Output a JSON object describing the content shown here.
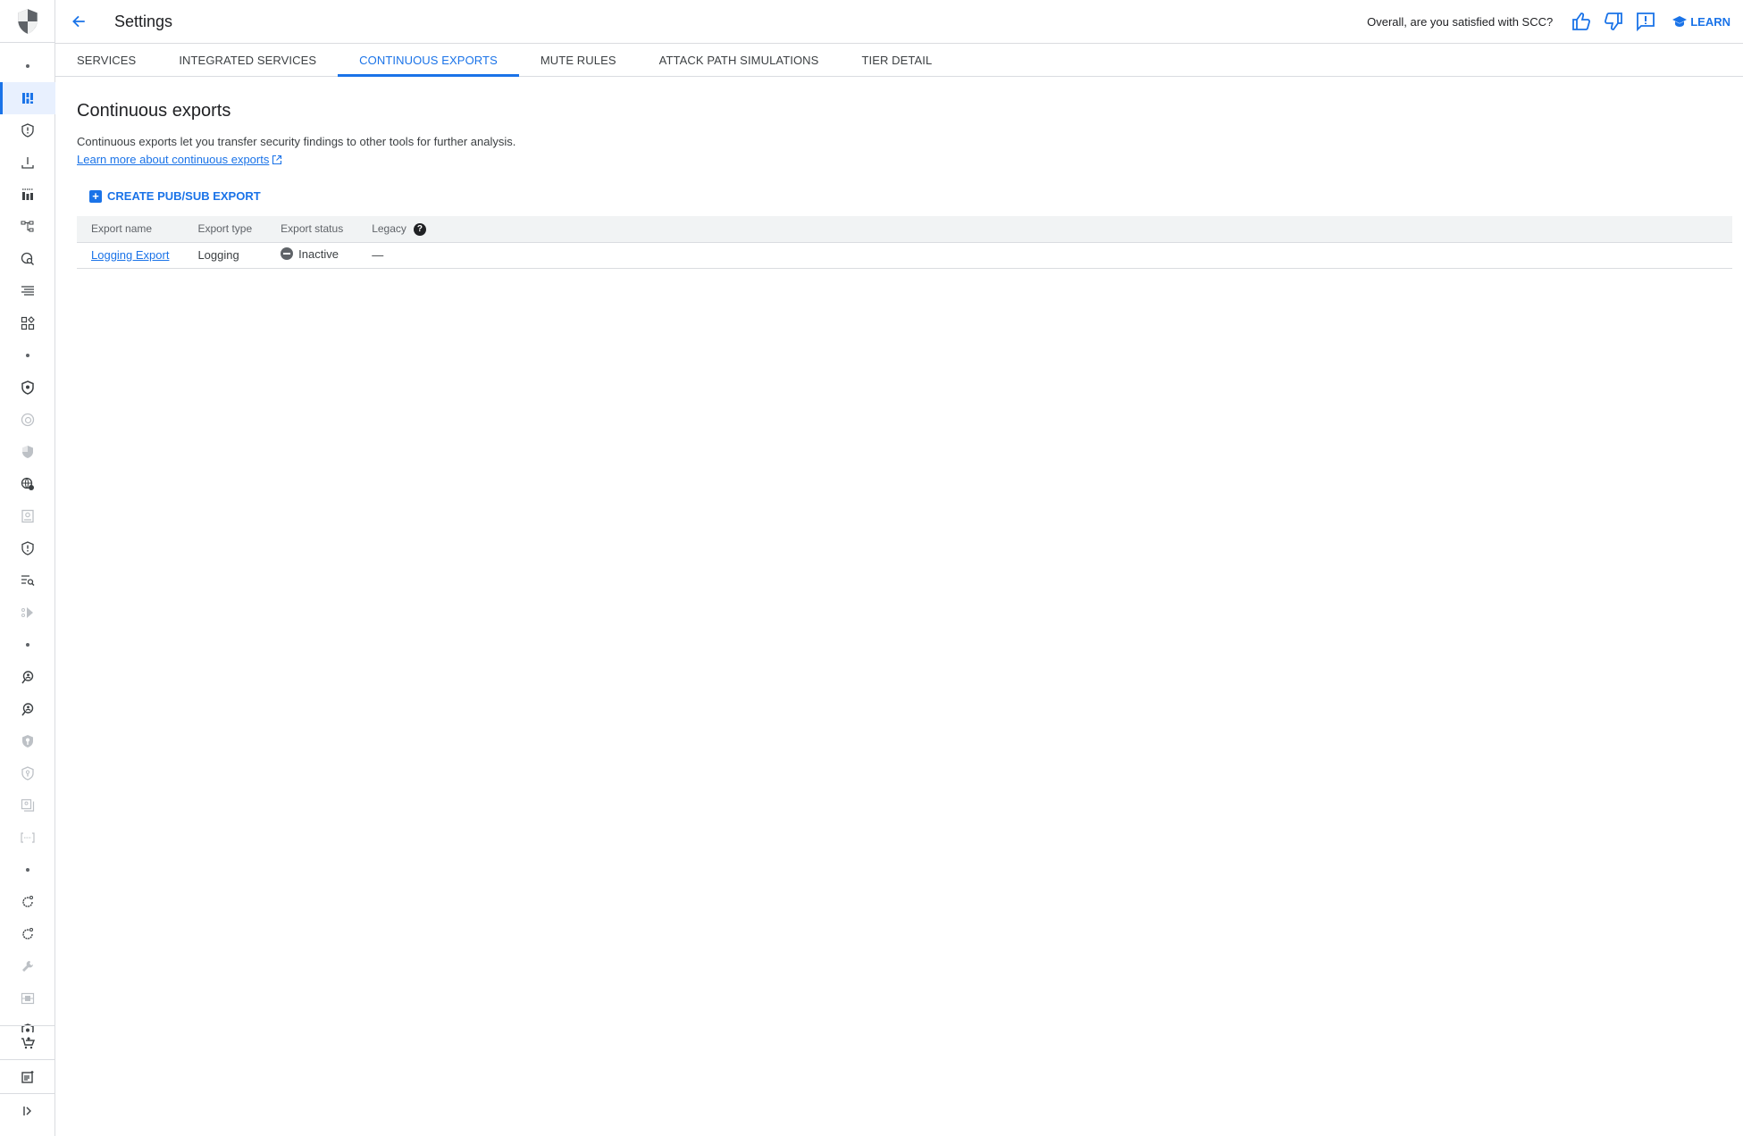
{
  "header": {
    "title": "Settings",
    "feedback_question": "Overall, are you satisfied with SCC?",
    "learn_label": "LEARN",
    "icons": [
      "back-arrow-icon",
      "thumb-up-icon",
      "thumb-down-icon",
      "feedback-icon",
      "school-icon"
    ]
  },
  "tabs": [
    {
      "label": "SERVICES",
      "active": false
    },
    {
      "label": "INTEGRATED SERVICES",
      "active": false
    },
    {
      "label": "CONTINUOUS EXPORTS",
      "active": true
    },
    {
      "label": "MUTE RULES",
      "active": false
    },
    {
      "label": "ATTACK PATH SIMULATIONS",
      "active": false
    },
    {
      "label": "TIER DETAIL",
      "active": false
    }
  ],
  "main": {
    "heading": "Continuous exports",
    "description": "Continuous exports let you transfer security findings to other tools for further analysis.",
    "learn_more_link": "Learn more about continuous exports",
    "create_button": "CREATE PUB/SUB EXPORT",
    "table": {
      "columns": [
        "Export name",
        "Export type",
        "Export status",
        "Legacy"
      ],
      "rows": [
        {
          "name": "Logging Export",
          "type": "Logging",
          "status": "Inactive",
          "legacy": "—"
        }
      ]
    }
  },
  "sidebar": {
    "items": [
      {
        "icon": "dot",
        "active": false
      },
      {
        "icon": "dashboard-icon",
        "active": true
      },
      {
        "icon": "shield-alert-icon"
      },
      {
        "icon": "download-icon"
      },
      {
        "icon": "bar-chart-icon"
      },
      {
        "icon": "hierarchy-icon"
      },
      {
        "icon": "globe-search-icon"
      },
      {
        "icon": "list-icon"
      },
      {
        "icon": "widgets-icon"
      },
      {
        "icon": "dot"
      },
      {
        "icon": "shield-icon"
      },
      {
        "icon": "copyright-shield-icon"
      },
      {
        "icon": "security-shield-icon"
      },
      {
        "icon": "globe-add-icon"
      },
      {
        "icon": "badge-icon"
      },
      {
        "icon": "shield-alert-icon"
      },
      {
        "icon": "search-list-icon"
      },
      {
        "icon": "direction-icon"
      },
      {
        "icon": "dot"
      },
      {
        "icon": "person-search-icon"
      },
      {
        "icon": "person-search-icon"
      },
      {
        "icon": "shield-key-icon"
      },
      {
        "icon": "shield-lock-icon"
      },
      {
        "icon": "photo-stack-icon"
      },
      {
        "icon": "brackets-icon"
      },
      {
        "icon": "dot"
      },
      {
        "icon": "refresh-icon"
      },
      {
        "icon": "refresh-icon"
      },
      {
        "icon": "wrench-icon"
      },
      {
        "icon": "filter-frame-icon"
      },
      {
        "icon": "shield-icon"
      }
    ],
    "bottom": [
      "marketplace-cart-icon",
      "release-notes-icon",
      "expand-sidebar-icon"
    ]
  }
}
